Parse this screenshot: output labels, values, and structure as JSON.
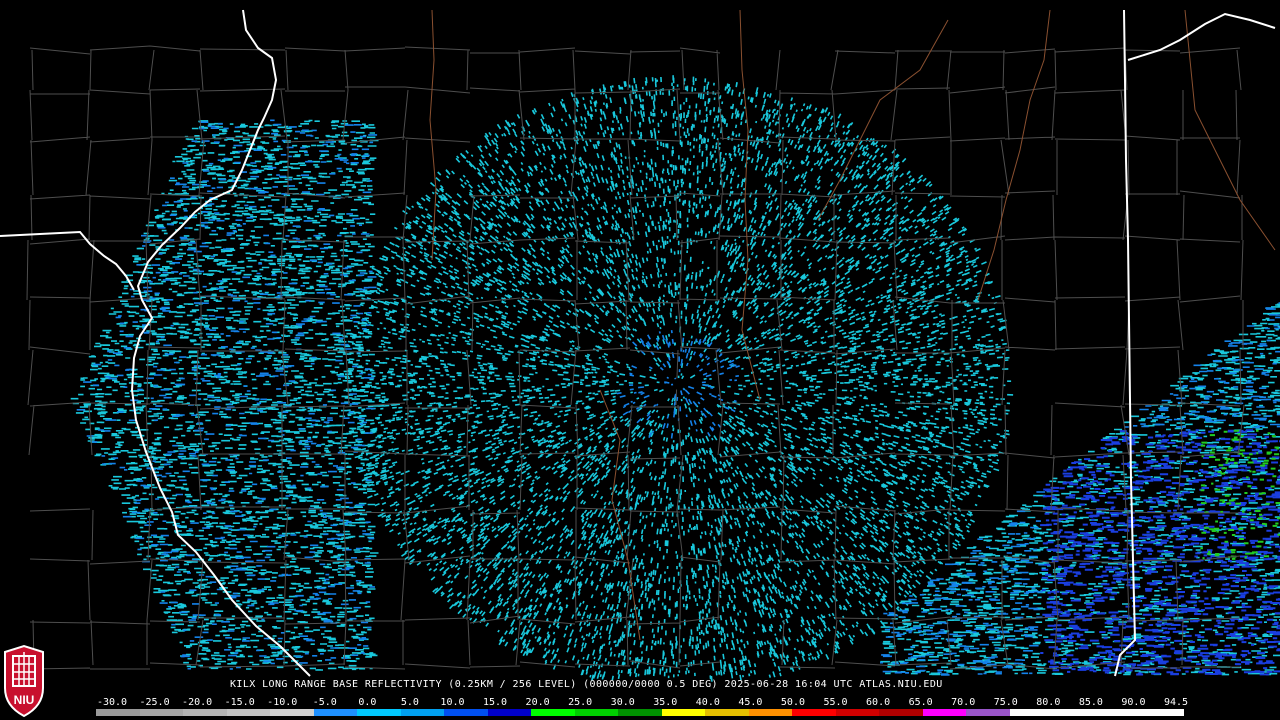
{
  "caption": "KILX LONG RANGE BASE REFLECTIVITY (0.25KM / 256 LEVEL) (000000/0000 0.5 DEG) 2025-06-28 16:04 UTC  ATLAS.NIU.EDU",
  "logo_text": "NIU",
  "scale": {
    "labels": [
      "-30.0",
      "-25.0",
      "-20.0",
      "-15.0",
      "-10.0",
      "-5.0",
      "0.0",
      "5.0",
      "10.0",
      "15.0",
      "20.0",
      "25.0",
      "30.0",
      "35.0",
      "40.0",
      "45.0",
      "50.0",
      "55.0",
      "60.0",
      "65.0",
      "70.0",
      "75.0",
      "80.0",
      "85.0",
      "90.0",
      "94.5"
    ],
    "colors": [
      "#9a9a9a",
      "#a6a6a6",
      "#b4b4b4",
      "#c2c2c2",
      "#d0d0d0",
      "#1e90ff",
      "#00c8ff",
      "#00a0f0",
      "#0050f0",
      "#0000c8",
      "#00ff00",
      "#00d000",
      "#009000",
      "#ffff00",
      "#e6c000",
      "#ff9000",
      "#ff0000",
      "#d00000",
      "#b00000",
      "#ff00ff",
      "#9955c9",
      "#ffffff",
      "#ffffff",
      "#ffffff",
      "#ffffff"
    ]
  },
  "colors": {
    "background": "#000000",
    "county_lines": "#4e4e4e",
    "state_lines": "#ffffff",
    "rivers": "#8a5030",
    "echo_light": "#19c8dc",
    "echo_medium": "#1482ea",
    "echo_strong": "#1a3ee0",
    "echo_green": "#22cc22"
  }
}
